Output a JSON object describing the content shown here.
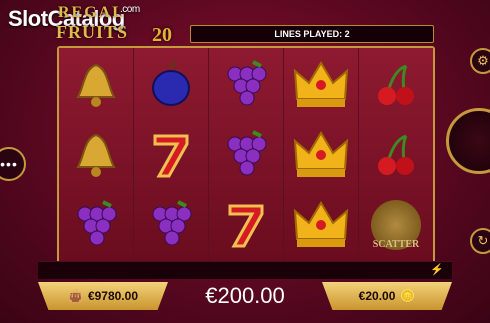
{
  "watermark": {
    "text": "SlotCatalog",
    "dotcom": ".com"
  },
  "game_logo": {
    "line1": "REGAL",
    "line2": "FRUITS",
    "number": "20"
  },
  "lines_played": "LINES PLAYED: 2",
  "reels": [
    [
      "bell-icon",
      "bell-icon",
      "grapes-icon"
    ],
    [
      "plum-icon",
      "seven-icon",
      "grapes-icon"
    ],
    [
      "grapes-icon",
      "grapes-icon",
      "seven-icon"
    ],
    [
      "crown-icon",
      "crown-icon",
      "crown-icon"
    ],
    [
      "cherry-icon",
      "cherry-icon",
      "scatter-icon"
    ]
  ],
  "scatter_label": "SCATTER",
  "balance": "€9780.00",
  "win": "€200.00",
  "bet": "€20.00",
  "colors": {
    "accent": "#c59a3c",
    "background": "#6a0c22",
    "button": "#e3b84a"
  }
}
